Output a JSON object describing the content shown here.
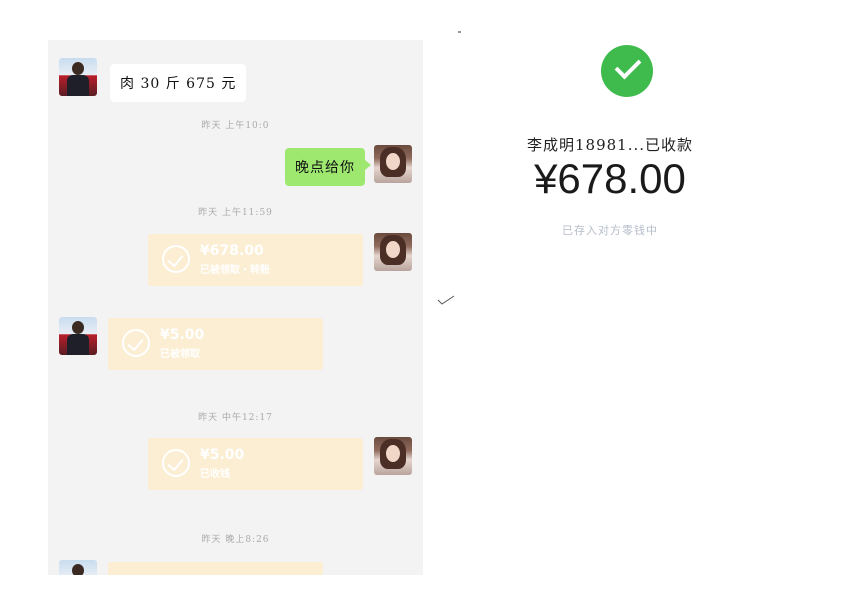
{
  "chat": {
    "messages": [
      {
        "side": "left",
        "text": "肉 30 斤 675 元"
      },
      {
        "time": "昨天 上午10:0"
      },
      {
        "side": "right",
        "text": "晚点给你"
      },
      {
        "time": "昨天 上午11:59"
      },
      {
        "side": "right",
        "transfer": {
          "amount": "¥678.00",
          "status": "已被领取・转账"
        }
      },
      {
        "side": "left",
        "transfer": {
          "amount": "¥5.00",
          "status": "已被领取"
        }
      },
      {
        "time": "昨天 中午12:17"
      },
      {
        "side": "right",
        "transfer": {
          "amount": "¥5.00",
          "status": "已收钱"
        }
      },
      {
        "time": "昨天 晚上8:26"
      }
    ]
  },
  "receipt": {
    "payee": "李成明18981...已收款",
    "amount": "¥678.00",
    "note": "已存入对方零钱中",
    "accent_color": "#3fbb4e"
  }
}
